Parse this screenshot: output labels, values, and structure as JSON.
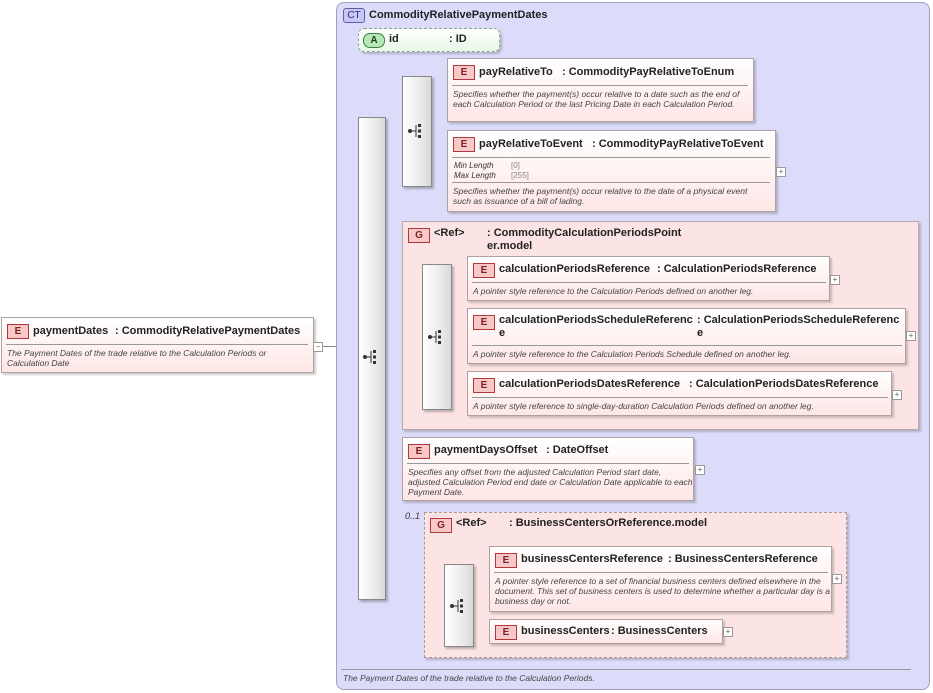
{
  "root": {
    "badge": "E",
    "name": "paymentDates",
    "type": ": CommodityRelativePaymentDates",
    "doc": "The Payment Dates of the trade relative to the Calculation Periods or Calculation Date",
    "collapse": "−"
  },
  "complex_type": {
    "badge": "CT",
    "name": "CommodityRelativePaymentDates",
    "doc": "The Payment Dates of the trade relative to the Calculation Periods."
  },
  "attribute": {
    "badge": "A",
    "name": "id",
    "type": ": ID"
  },
  "pay_relative_to": {
    "badge": "E",
    "name": "payRelativeTo",
    "type": ": CommodityPayRelativeToEnum",
    "doc": "Specifies whether the payment(s) occur relative to a date such as the end of each Calculation Period or the last Pricing Date in each Calculation Period."
  },
  "pay_relative_to_event": {
    "badge": "E",
    "name": "payRelativeToEvent",
    "type": ": CommodityPayRelativeToEvent",
    "facets": [
      {
        "label": "Min Length",
        "value": "[0]"
      },
      {
        "label": "Max Length",
        "value": "[255]"
      }
    ],
    "doc": "Specifies whether the payment(s) occur relative to the date of a physical event such as issuance of a bill of lading.",
    "expand": "+"
  },
  "group_calc": {
    "badge": "G",
    "ref": "<Ref>",
    "type": ": CommodityCalculationPeriodsPointer.model",
    "items": [
      {
        "badge": "E",
        "name": "calculationPeriodsReference",
        "type": ": CalculationPeriodsReference",
        "doc": "A pointer style reference to the Calculation Periods defined on another leg.",
        "expand": "+"
      },
      {
        "badge": "E",
        "name": "calculationPeriodsScheduleReference",
        "type": ": CalculationPeriodsScheduleReference",
        "doc": "A pointer style reference to the Calculation Periods Schedule defined on another leg.",
        "expand": "+"
      },
      {
        "badge": "E",
        "name": "calculationPeriodsDatesReference",
        "type": ": CalculationPeriodsDatesReference",
        "doc": "A pointer style reference to single-day-duration Calculation Periods defined on another leg.",
        "expand": "+"
      }
    ]
  },
  "payment_days_offset": {
    "badge": "E",
    "name": "paymentDaysOffset",
    "type": ": DateOffset",
    "doc": "Specifies any offset from the adjusted Calculation Period start date, adjusted Calculation Period end date or Calculation Date applicable to each Payment Date.",
    "expand": "+"
  },
  "group_bc": {
    "cardinality": "0..1",
    "badge": "G",
    "ref": "<Ref>",
    "type": ": BusinessCentersOrReference.model",
    "items": [
      {
        "badge": "E",
        "name": "businessCentersReference",
        "type": ": BusinessCentersReference",
        "doc": "A pointer style reference to a set of financial business centers defined elsewhere in the document. This set of business centers is used to determine whether a particular day is a business day or not.",
        "expand": "+"
      },
      {
        "badge": "E",
        "name": "businessCenters",
        "type": ": BusinessCenters",
        "expand": "+"
      }
    ]
  }
}
